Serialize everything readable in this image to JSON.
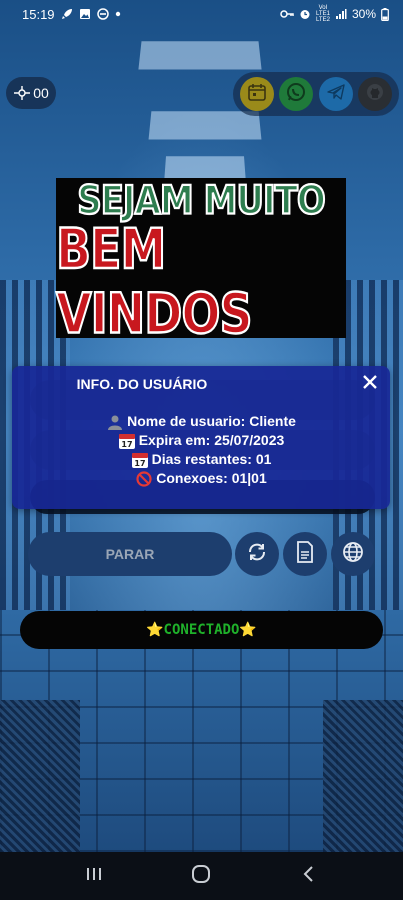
{
  "status_bar": {
    "time": "15:19",
    "battery": "30%",
    "network_top": "VoI",
    "network_mid": "LTE1",
    "network_bot": "LTE2"
  },
  "top": {
    "speed_value": "00",
    "social_icons": [
      "calendar-icon",
      "whatsapp-icon",
      "telegram-icon",
      "github-icon"
    ]
  },
  "banner": {
    "line1": "SEJAM MUITO",
    "line2": "BEM VINDOS"
  },
  "controls": {
    "stop_label": "PARAR"
  },
  "connection": {
    "status_text": "⭐CONECTADO⭐"
  },
  "dialog": {
    "title": "INFO. DO USUÁRIO",
    "username_line": "Nome de usuario: Cliente",
    "expires_line": "Expira em: 25/07/2023",
    "days_line": "Dias restantes: 01",
    "connections_line": "Conexoes: 01|01"
  },
  "colors": {
    "dialog_bg": "#1828a0",
    "connected_text": "#1fb12a",
    "banner_green": "#2e7d4f",
    "banner_red": "#c8181f"
  }
}
